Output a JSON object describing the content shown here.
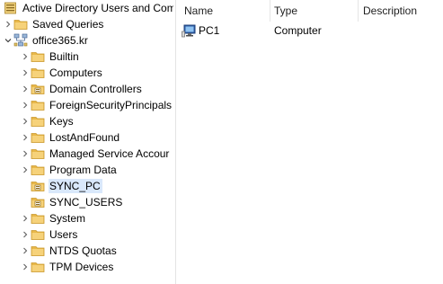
{
  "tree": {
    "root": {
      "label": "Active Directory Users and Com",
      "icon": "ad-console-icon"
    },
    "saved_queries": {
      "label": "Saved Queries",
      "icon": "folder-icon"
    },
    "domain": {
      "label": "office365.kr",
      "icon": "domain-icon",
      "expanded": true
    },
    "children": [
      {
        "label": "Builtin",
        "icon": "folder-icon"
      },
      {
        "label": "Computers",
        "icon": "folder-icon"
      },
      {
        "label": "Domain Controllers",
        "icon": "ou-icon"
      },
      {
        "label": "ForeignSecurityPrincipals",
        "icon": "folder-icon"
      },
      {
        "label": "Keys",
        "icon": "folder-icon"
      },
      {
        "label": "LostAndFound",
        "icon": "folder-icon"
      },
      {
        "label": "Managed Service Accour",
        "icon": "folder-icon"
      },
      {
        "label": "Program Data",
        "icon": "folder-icon"
      },
      {
        "label": "SYNC_PC",
        "icon": "ou-icon",
        "selected": true
      },
      {
        "label": "SYNC_USERS",
        "icon": "ou-icon"
      },
      {
        "label": "System",
        "icon": "folder-icon"
      },
      {
        "label": "Users",
        "icon": "folder-icon"
      },
      {
        "label": "NTDS Quotas",
        "icon": "folder-icon"
      },
      {
        "label": "TPM Devices",
        "icon": "folder-icon"
      }
    ]
  },
  "list": {
    "columns": [
      "Name",
      "Type",
      "Description"
    ],
    "rows": [
      {
        "name": "PC1",
        "type": "Computer",
        "description": "",
        "icon": "computer-icon"
      }
    ]
  },
  "colors": {
    "folder": "#e8b84a",
    "folder_dark": "#c9962a",
    "selection": "#d9e8fb"
  }
}
